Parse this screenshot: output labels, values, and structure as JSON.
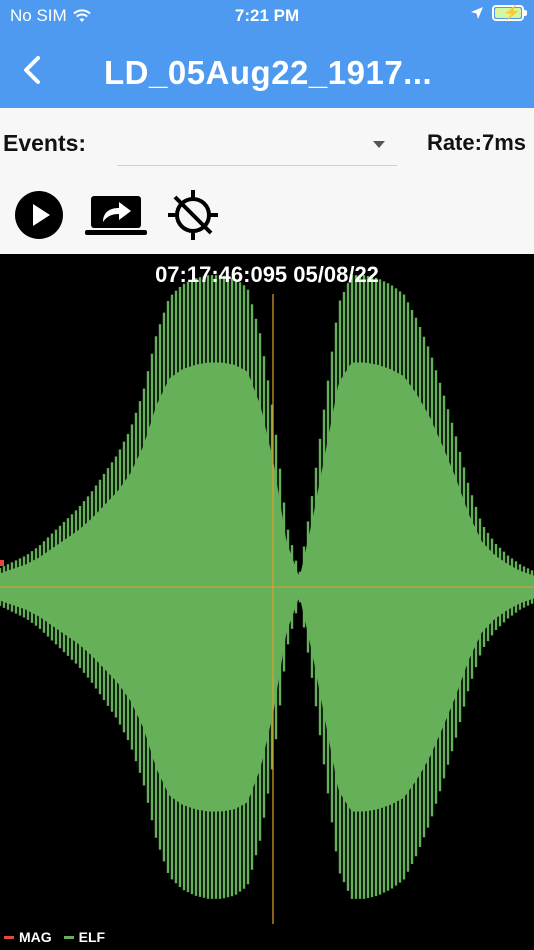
{
  "status_bar": {
    "carrier": "No SIM",
    "time": "7:21 PM"
  },
  "header": {
    "title": "LD_05Aug22_1917...",
    "background": "#4d9af0"
  },
  "controls": {
    "events_label": "Events:",
    "events_value": "",
    "rate_label": "Rate:",
    "rate_value": "7ms"
  },
  "toolbar": {
    "icons": [
      "play-icon",
      "share-screen-icon",
      "no-location-icon"
    ]
  },
  "chart": {
    "timestamp": "07:17:46:095 05/08/22",
    "background": "#000000",
    "elf_color": "#66b05a",
    "mag_color": "#e24a3b",
    "cursor_color": "#e0a030"
  },
  "legend": {
    "items": [
      {
        "label": "MAG",
        "color": "#e24a3b"
      },
      {
        "label": "ELF",
        "color": "#66b05a"
      }
    ]
  },
  "chart_data": {
    "type": "area",
    "series": [
      {
        "name": "MAG",
        "values": []
      },
      {
        "name": "ELF",
        "envelope_fraction": [
          0.06,
          0.08,
          0.1,
          0.13,
          0.17,
          0.21,
          0.25,
          0.3,
          0.36,
          0.42,
          0.5,
          0.62,
          0.8,
          0.92,
          0.96,
          0.98,
          0.99,
          0.99,
          0.98,
          0.95,
          0.8,
          0.55,
          0.2,
          0.04,
          0.3,
          0.6,
          0.9,
          0.99,
          0.99,
          0.98,
          0.96,
          0.93,
          0.85,
          0.75,
          0.62,
          0.48,
          0.32,
          0.2,
          0.14,
          0.1,
          0.07,
          0.05
        ]
      }
    ]
  }
}
